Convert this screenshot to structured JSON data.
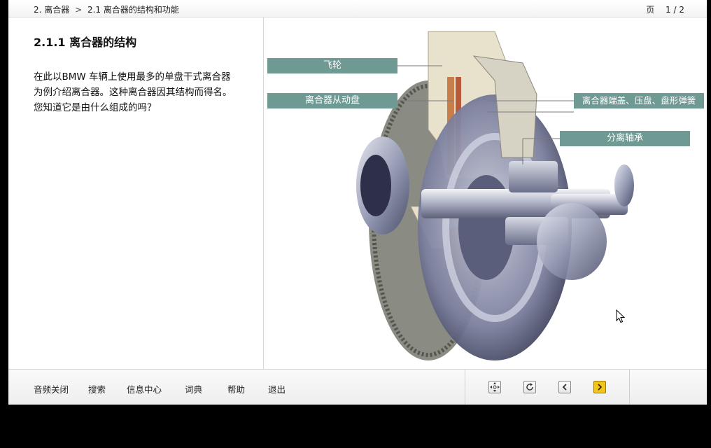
{
  "header": {
    "breadcrumb": [
      "2. 离合器",
      "2.1 离合器的结构和功能"
    ],
    "separator": ">",
    "page_label": "页",
    "page_value": "1 / 2"
  },
  "content": {
    "title": "2.1.1 离合器的结构",
    "body": "在此以BMW 车辆上使用最多的单盘干式离合器为例介绍离合器。这种离合器因其结构而得名。您知道它是由什么组成的吗？"
  },
  "diagram": {
    "callouts": {
      "flywheel": "飞轮",
      "disc": "离合器从动盘",
      "cover": "离合器端盖、压盘、盘形弹簧",
      "bearing": "分离轴承"
    },
    "callout_color": "#6f9a94"
  },
  "toolbar": {
    "menu": [
      "音频关闭",
      "搜索",
      "信息中心",
      "词典",
      "帮助",
      "退出"
    ],
    "nav_icons": [
      "move-icon",
      "reload-icon",
      "prev-page-icon",
      "next-page-icon"
    ],
    "active_color": "#f3c419"
  }
}
